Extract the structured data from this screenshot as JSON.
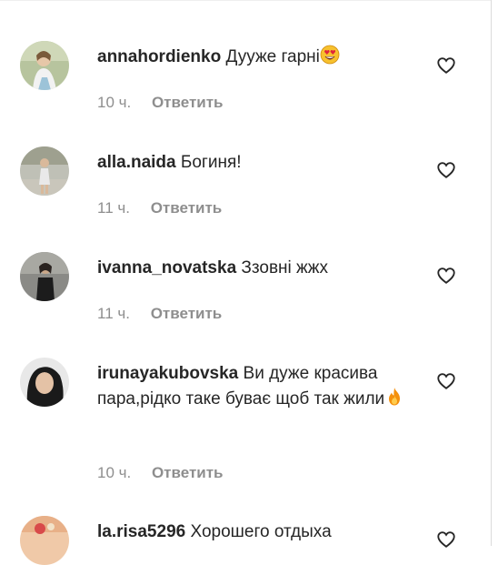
{
  "comments": [
    {
      "username": "annahordienko",
      "text": "Дууже гарні",
      "emoji": "heart-eyes-emoji",
      "time": "10 ч.",
      "reply": "Ответить",
      "avatar_color": "#9fb48a"
    },
    {
      "username": "alla.naida",
      "text": "Богиня!",
      "time": "11 ч.",
      "reply": "Ответить",
      "avatar_color": "#a9a9a0"
    },
    {
      "username": "ivanna_novatska",
      "text": "Ззовні жжх",
      "time": "11 ч.",
      "reply": "Ответить",
      "avatar_color": "#6f6f6f"
    },
    {
      "username": "irunayakubovska",
      "text": "Ви дуже красива пара,рідко таке буває щоб так жили",
      "emoji": "fire-emoji",
      "time": "10 ч.",
      "reply": "Ответить",
      "avatar_color": "#5a5a5a"
    },
    {
      "username": "la.risa5296",
      "text": "Хорошего отдыха",
      "avatar_color": "#e0b090"
    }
  ],
  "colors": {
    "text": "#262626",
    "meta": "#8e8e8e",
    "divider": "#dbdbdb"
  }
}
